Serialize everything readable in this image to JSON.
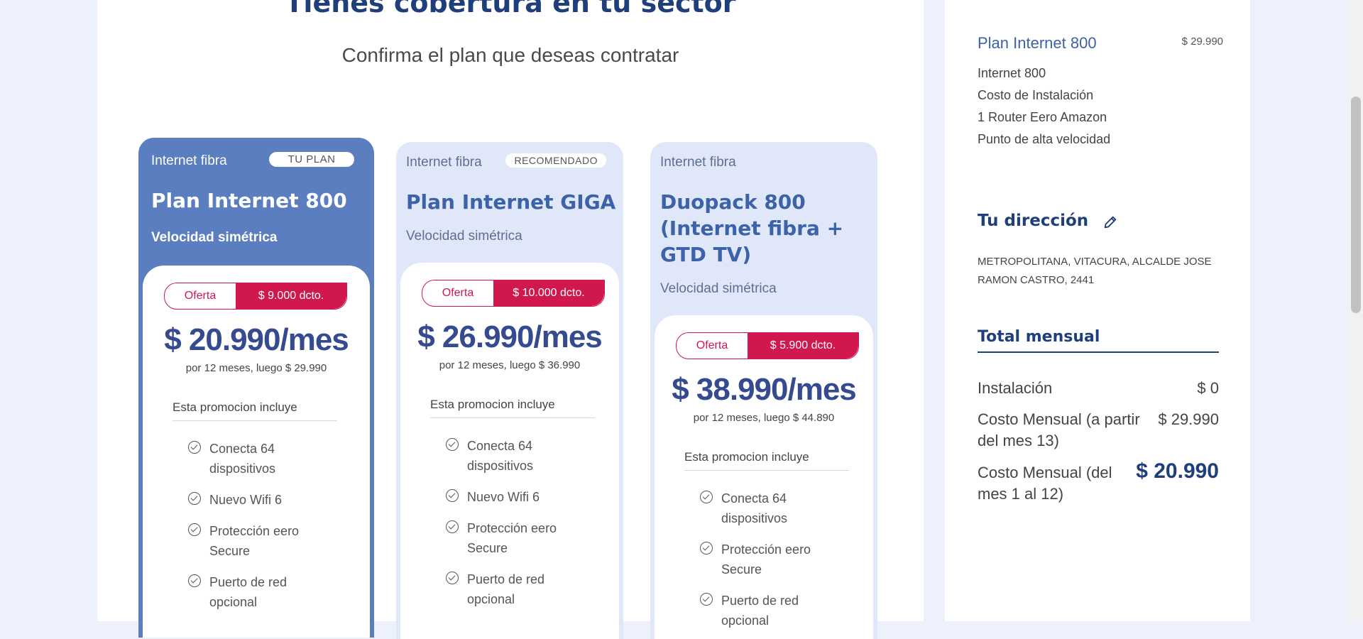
{
  "header": {
    "title": "Tienes cobertura en tu sector",
    "subtitle": "Confirma el plan que deseas contratar"
  },
  "plans": [
    {
      "type": "Internet fibra",
      "badge": "TU PLAN",
      "name": "Plan Internet 800",
      "speed": "Velocidad simétrica",
      "offer_label": "Oferta",
      "discount": "$ 9.000 dcto.",
      "price": "$ 20.990/mes",
      "price_note": "por 12 meses, luego $ 29.990",
      "includes_title": "Esta promocion incluye",
      "features": [
        "Conecta 64 dispositivos",
        "Nuevo Wifi 6",
        "Protección eero Secure",
        "Puerto de red opcional"
      ]
    },
    {
      "type": "Internet fibra",
      "badge": "RECOMENDADO",
      "name": "Plan Internet GIGA",
      "speed": "Velocidad simétrica",
      "offer_label": "Oferta",
      "discount": "$ 10.000 dcto.",
      "price": "$ 26.990/mes",
      "price_note": "por 12 meses, luego $ 36.990",
      "includes_title": "Esta promocion incluye",
      "features": [
        "Conecta 64 dispositivos",
        "Nuevo Wifi 6",
        "Protección eero Secure",
        "Puerto de red opcional"
      ]
    },
    {
      "type": "Internet fibra",
      "name": "Duopack 800 (Internet fibra + GTD TV)",
      "speed": "Velocidad simétrica",
      "offer_label": "Oferta",
      "discount": "$ 5.900 dcto.",
      "price": "$ 38.990/mes",
      "price_note": "por 12 meses, luego $ 44.890",
      "includes_title": "Esta promocion incluye",
      "features": [
        "Conecta 64 dispositivos",
        "Protección eero Secure",
        "Puerto de red opcional"
      ]
    }
  ],
  "summary": {
    "plan_name": "Plan Internet 800",
    "plan_price": "$ 29.990",
    "items": [
      "Internet 800",
      "Costo de Instalación",
      "1 Router Eero Amazon",
      "Punto de alta velocidad"
    ],
    "address_title": "Tu dirección",
    "edit_icon": "pencil-icon",
    "address": "METROPOLITANA, VITACURA, ALCALDE JOSE RAMON CASTRO, 2441",
    "total_title": "Total mensual",
    "install_label": "Instalación",
    "install_value": "$ 0",
    "monthly_after_label": "Costo Mensual (a partir del mes 13)",
    "monthly_after_value": "$ 29.990",
    "monthly_promo_label": "Costo Mensual (del mes 1 al 12)",
    "monthly_promo_value": "$ 20.990"
  },
  "colors": {
    "brand_blue": "#1f3f7a",
    "selected_card": "#5a7ebf",
    "card_bg": "#dfe7f8",
    "offer_red": "#d0184f"
  }
}
